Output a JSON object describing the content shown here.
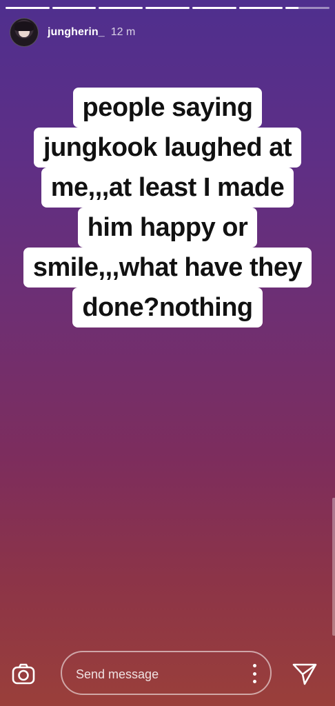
{
  "story": {
    "progress_segments": [
      1,
      1,
      1,
      1,
      1,
      1,
      0.3
    ]
  },
  "header": {
    "username": "jungherin_",
    "time": "12 m"
  },
  "caption": {
    "lines": [
      "people saying",
      "jungkook laughed at",
      "me,,,at least I made",
      "him happy or",
      "smile,,,what have they",
      "done?nothing"
    ]
  },
  "footer": {
    "message_placeholder": "Send message",
    "icons": {
      "camera": "camera-icon",
      "more": "more-vertical-icon",
      "send": "send-icon"
    }
  }
}
